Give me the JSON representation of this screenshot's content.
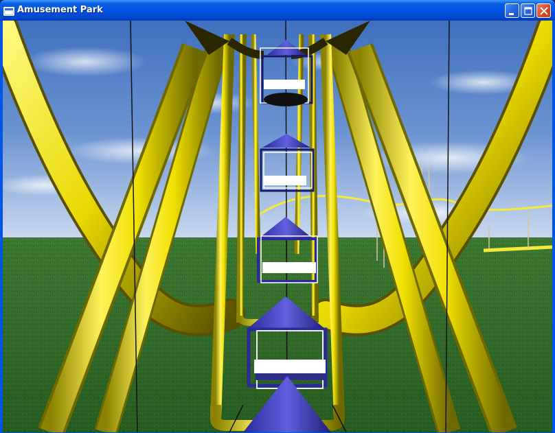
{
  "window": {
    "title": "Amusement Park",
    "app_icon": "window-app-icon",
    "controls": [
      "minimize-icon",
      "maximize-icon",
      "close-icon"
    ],
    "colors": {
      "titlebar": "#0054e3",
      "close_button": "#dc4a26"
    }
  },
  "scene": {
    "description_objects": [
      "sky",
      "grass-ground",
      "ferris-wheel-frame",
      "gondolas",
      "roller-coaster-track"
    ],
    "colors": {
      "sky": "#5b86c9",
      "grass": "#2f6b2a",
      "frame": "#f2e600",
      "gondola": "#3c3cc4",
      "coaster_track": "#f5e93a"
    }
  }
}
